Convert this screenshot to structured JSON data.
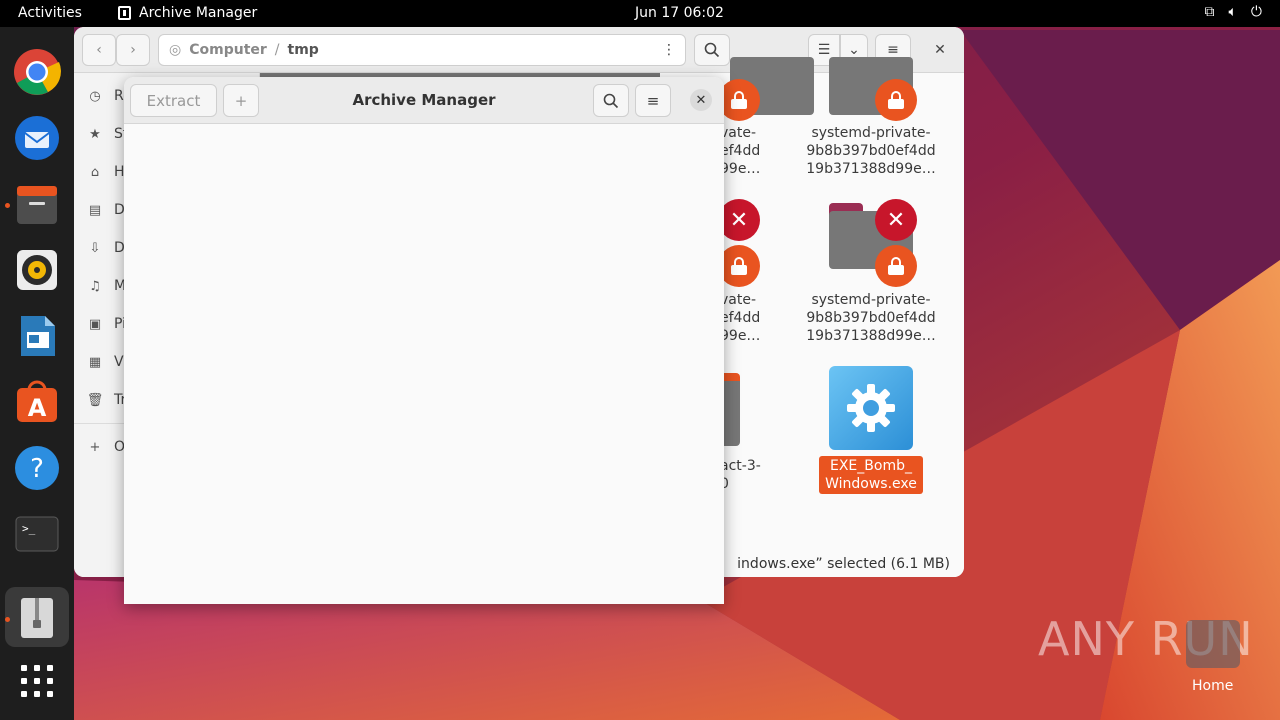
{
  "topbar": {
    "activities": "Activities",
    "app_name": "Archive Manager",
    "clock": "Jun 17  06:02"
  },
  "dock": {
    "items": [
      "chrome-icon",
      "thunderbird-icon",
      "files-icon",
      "rhythmbox-icon",
      "libreoffice-writer-icon",
      "app-center-icon",
      "help-icon",
      "terminal-icon",
      "archive-manager-icon",
      "show-apps-icon"
    ]
  },
  "files": {
    "path": [
      "Computer",
      "tmp"
    ],
    "sidebar": [
      "Re",
      "St",
      "H",
      "D",
      "D",
      "M",
      "Pi",
      "Vi",
      "Tr",
      "O"
    ],
    "tiles": [
      {
        "line1": "systemd-private-",
        "line2": "9b8b397bd0ef4dd",
        "line3": "19b371388d99e…"
      },
      {
        "line1": "systemd-private-",
        "line2": "9b8b397bd0ef4dd",
        "line3": "19b371388d99e…"
      }
    ],
    "partial_tiles": [
      {
        "line1": "vate-",
        "line2": "ef4dd",
        "line3": "99e…"
      },
      {
        "line1": "vate-",
        "line2": "ef4dd",
        "line3": "99e…"
      },
      {
        "line1": "act-3-",
        "line2": "0"
      }
    ],
    "selected_file": {
      "line1": "EXE_Bomb_",
      "line2": "Windows.exe"
    },
    "status": "indows.exe” selected (6.1 MB)"
  },
  "archive": {
    "title": "Archive Manager",
    "extract_label": "Extract",
    "add_label": "+"
  },
  "desktop": {
    "watermark": "ANY RUN",
    "home_label": "Home"
  },
  "colors": {
    "accent": "#e95420",
    "error": "#c7162b"
  }
}
